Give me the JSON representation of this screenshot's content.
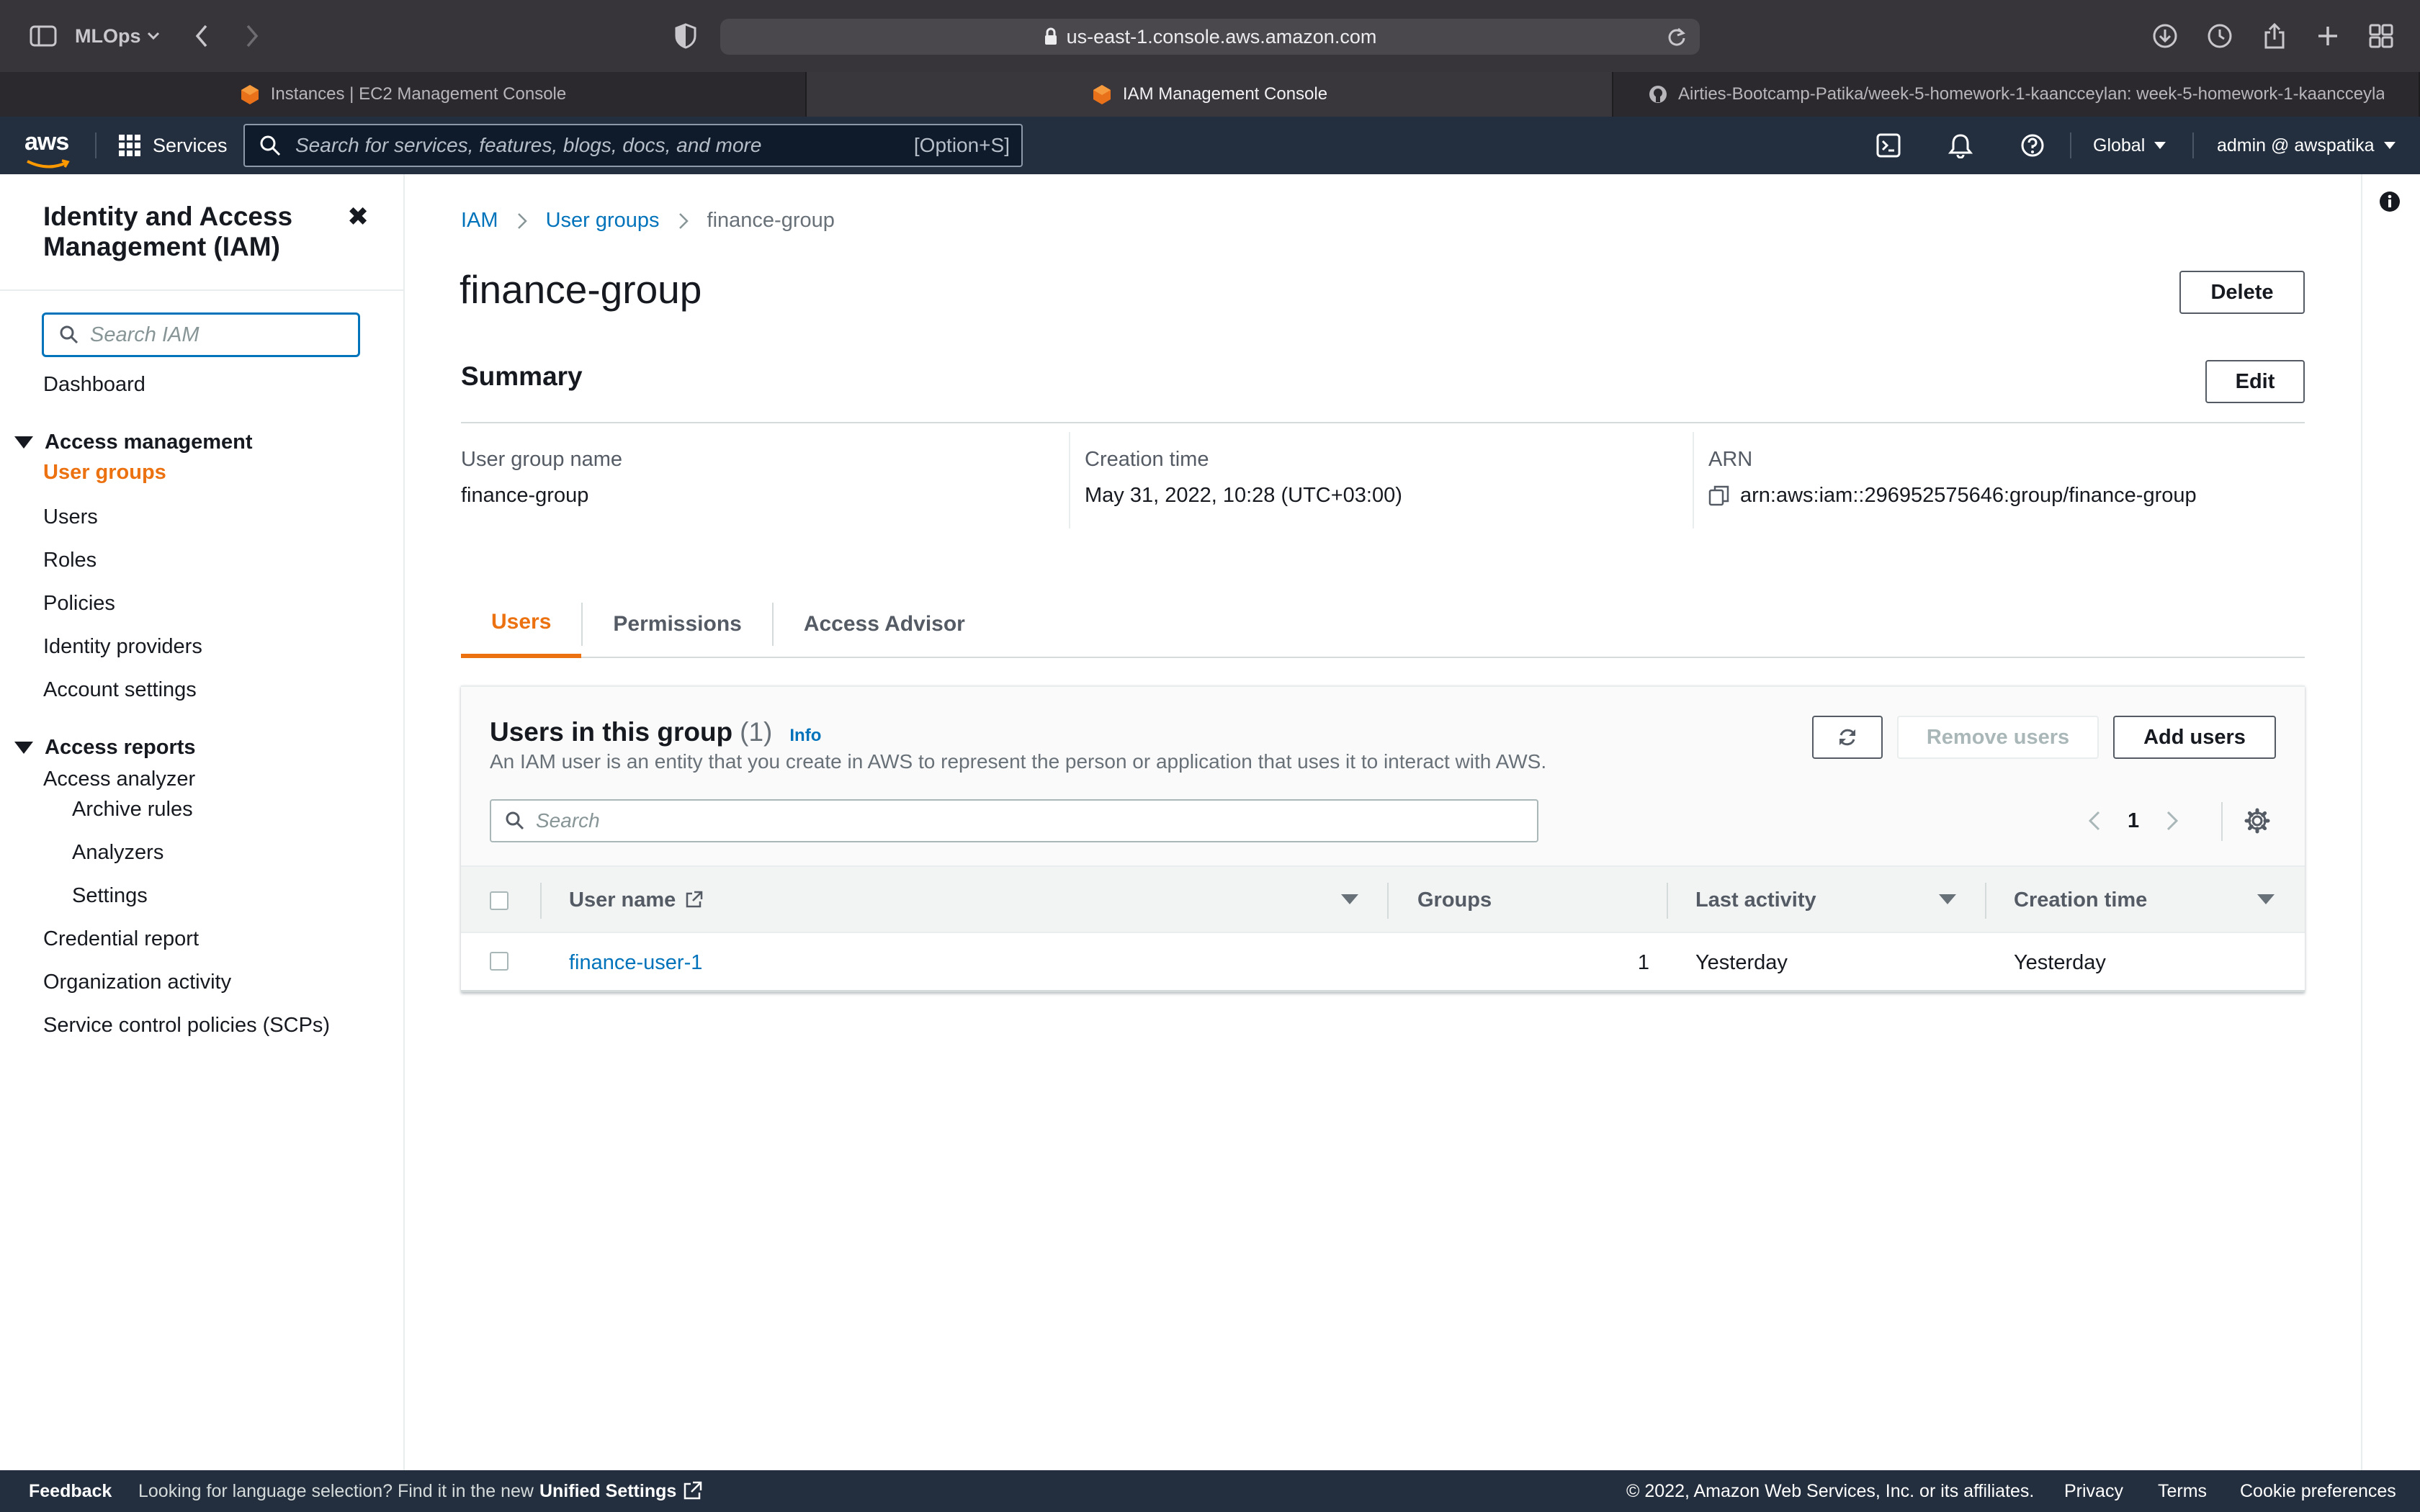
{
  "browser": {
    "profile": "MLOps",
    "url": "us-east-1.console.aws.amazon.com",
    "tabs": [
      {
        "title": "Instances | EC2 Management Console"
      },
      {
        "title": "IAM Management Console"
      },
      {
        "title": "Airties-Bootcamp-Patika/week-5-homework-1-kaancceylan: week-5-homework-1-kaancceylan..."
      }
    ]
  },
  "awsnav": {
    "logo": "aws",
    "services_label": "Services",
    "search_placeholder": "Search for services, features, blogs, docs, and more",
    "search_shortcut": "[Option+S]",
    "region": "Global",
    "account": "admin @ awspatika"
  },
  "sidebar": {
    "title": "Identity and Access Management (IAM)",
    "search_placeholder": "Search IAM",
    "dashboard": "Dashboard",
    "access_management": {
      "label": "Access management",
      "items": [
        "User groups",
        "Users",
        "Roles",
        "Policies",
        "Identity providers",
        "Account settings"
      ]
    },
    "access_reports": {
      "label": "Access reports",
      "analyzer": "Access analyzer",
      "analyzer_items": [
        "Archive rules",
        "Analyzers",
        "Settings"
      ],
      "items": [
        "Credential report",
        "Organization activity",
        "Service control policies (SCPs)"
      ]
    }
  },
  "breadcrumb": {
    "items": [
      "IAM",
      "User groups"
    ],
    "current": "finance-group"
  },
  "page": {
    "title": "finance-group",
    "delete_label": "Delete",
    "summary_title": "Summary",
    "edit_label": "Edit",
    "summary": {
      "group_name_label": "User group name",
      "group_name_value": "finance-group",
      "creation_label": "Creation time",
      "creation_value": "May 31, 2022, 10:28 (UTC+03:00)",
      "arn_label": "ARN",
      "arn_value": "arn:aws:iam::296952575646:group/finance-group"
    },
    "tabs": [
      "Users",
      "Permissions",
      "Access Advisor"
    ]
  },
  "users_panel": {
    "title": "Users in this group",
    "count": "(1)",
    "info": "Info",
    "description": "An IAM user is an entity that you create in AWS to represent the person or application that uses it to interact with AWS.",
    "remove_label": "Remove users",
    "add_label": "Add users",
    "search_placeholder": "Search",
    "page": "1",
    "columns": [
      "User name",
      "Groups",
      "Last activity",
      "Creation time"
    ],
    "rows": [
      {
        "user_name": "finance-user-1",
        "groups": "1",
        "last_activity": "Yesterday",
        "creation_time": "Yesterday"
      }
    ]
  },
  "footer": {
    "feedback": "Feedback",
    "language_text": "Looking for language selection? Find it in the new",
    "unified_settings": "Unified Settings",
    "copyright": "© 2022, Amazon Web Services, Inc. or its affiliates.",
    "privacy": "Privacy",
    "terms": "Terms",
    "cookie": "Cookie preferences"
  },
  "colors": {
    "accent": "#ec7211",
    "link": "#0073bb",
    "nav_bg": "#232f3e"
  }
}
